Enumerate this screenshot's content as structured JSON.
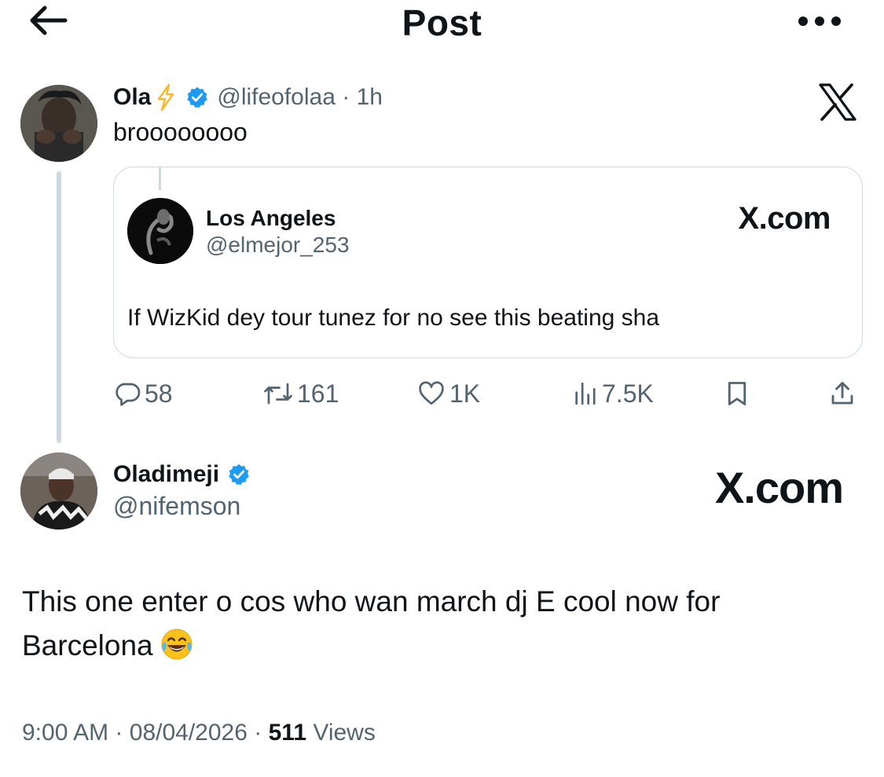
{
  "header": {
    "title": "Post"
  },
  "tweet": {
    "author_name": "Ola",
    "handle": "@lifeofolaa",
    "separator": "·",
    "time_ago": "1h",
    "text": "broooooooo",
    "quoted": {
      "author_name": "Los Angeles",
      "handle": "@elmejor_253",
      "brand": "X.com",
      "text": "If WizKid dey tour tunez for no see this beating sha"
    },
    "stats": {
      "replies": "58",
      "reposts": "161",
      "likes": "1K",
      "views": "7.5K"
    }
  },
  "reply": {
    "author_name": "Oladimeji",
    "handle": "@nifemson",
    "brand": "X.com",
    "text": "This one enter o cos who wan march dj E cool now for Barcelona",
    "time": "9:00 AM",
    "date": "08/04/2026",
    "views_count": "511",
    "views_label": "Views",
    "separator": "·"
  },
  "colors": {
    "verified": "#1d9bf0",
    "bolt": "#f7b928",
    "muted": "#536471",
    "border": "#cfd9de"
  },
  "icons": [
    "back-arrow-icon",
    "more-icon",
    "x-logo-icon",
    "verified-badge-icon",
    "lightning-icon",
    "reply-icon",
    "repost-icon",
    "like-icon",
    "views-icon",
    "bookmark-icon",
    "share-icon",
    "laughing-tears-emoji-icon"
  ]
}
